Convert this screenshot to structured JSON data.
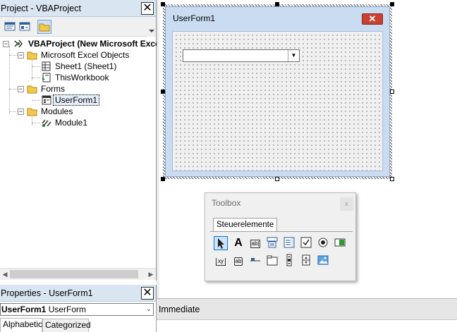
{
  "project": {
    "title": "Project - VBAProject",
    "close": "✕",
    "tree": {
      "root": "VBAProject (New Microsoft Excel",
      "folder_objects": "Microsoft Excel Objects",
      "sheet1": "Sheet1 (Sheet1)",
      "thisworkbook": "ThisWorkbook",
      "folder_forms": "Forms",
      "userform1": "UserForm1",
      "folder_modules": "Modules",
      "module1": "Module1"
    }
  },
  "properties": {
    "title": "Properties - UserForm1",
    "object_name": "UserForm1",
    "object_type": "UserForm",
    "tabs": [
      "Alphabetic",
      "Categorized"
    ]
  },
  "designer": {
    "form_caption": "UserForm1",
    "close": "✕"
  },
  "toolbox": {
    "title": "Toolbox",
    "close": "x",
    "tab": "Steuerelemente",
    "tools": [
      "pointer-tool",
      "label-tool",
      "textbox-tool",
      "combobox-tool",
      "listbox-tool",
      "checkbox-tool",
      "optionbutton-tool",
      "togglebutton-tool",
      "frame-tool",
      "commandbutton-tool",
      "tabstrip-tool",
      "multipage-tool",
      "scrollbar-tool",
      "spinbutton-tool",
      "image-tool"
    ],
    "glyphs": {
      "label": "A",
      "textbox": "ab|",
      "frame": "xy",
      "commandbutton": "ab"
    }
  },
  "immediate": {
    "title": "Immediate"
  },
  "colors": {
    "title_bar": "#dae5f2",
    "form_frame": "#c9dcf2",
    "form_close": "#c84031",
    "selection": "#0078d7"
  }
}
